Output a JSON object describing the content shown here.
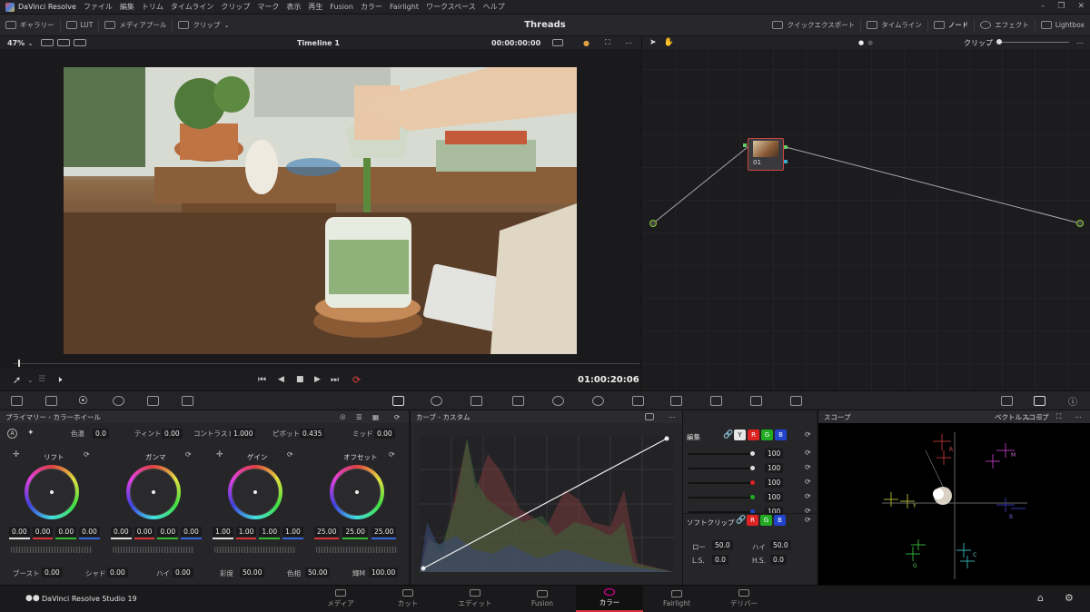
{
  "app": {
    "name": "DaVinci Resolve",
    "footer_name": "DaVinci Resolve Studio 19",
    "page_title": "Threads"
  },
  "menu": [
    "ファイル",
    "編集",
    "トリム",
    "タイムライン",
    "クリップ",
    "マーク",
    "表示",
    "再生",
    "Fusion",
    "カラー",
    "Fairlight",
    "ワークスペース",
    "ヘルプ"
  ],
  "toolbar": {
    "left": [
      "ギャラリー",
      "LUT",
      "メディアプール",
      "クリップ"
    ],
    "right": [
      "クイックエクスポート",
      "タイムライン",
      "ノード",
      "エフェクト",
      "Lightbox"
    ]
  },
  "viewer": {
    "zoom": "47%",
    "timeline_name": "Timeline 1",
    "timecode_top": "00:00:00:00",
    "timecode": "01:00:20:06",
    "progress": 0.01
  },
  "nodes": {
    "dropdown": "クリップ",
    "node_label": "01"
  },
  "primaries": {
    "title": "プライマリー - カラーホイール",
    "top_params": [
      {
        "label": "色温",
        "value": "0.0"
      },
      {
        "label": "ティント",
        "value": "0.00"
      },
      {
        "label": "コントラスト",
        "value": "1.000"
      },
      {
        "label": "ピボット",
        "value": "0.435"
      },
      {
        "label": "ミッド",
        "value": "0.00"
      }
    ],
    "wheels": [
      {
        "name": "リフト",
        "values": [
          "0.00",
          "0.00",
          "0.00",
          "0.00"
        ]
      },
      {
        "name": "ガンマ",
        "values": [
          "0.00",
          "0.00",
          "0.00",
          "0.00"
        ]
      },
      {
        "name": "ゲイン",
        "values": [
          "1.00",
          "1.00",
          "1.00",
          "1.00"
        ]
      },
      {
        "name": "オフセット",
        "values": [
          "25.00",
          "25.00",
          "25.00"
        ]
      }
    ],
    "bottom_params": [
      {
        "label": "ブースト",
        "value": "0.00"
      },
      {
        "label": "シャド",
        "value": "0.00"
      },
      {
        "label": "ハイ",
        "value": "0.00"
      },
      {
        "label": "彩度",
        "value": "50.00"
      },
      {
        "label": "色相",
        "value": "50.00"
      },
      {
        "label": "輝M",
        "value": "100.00"
      }
    ]
  },
  "curves": {
    "title": "カーブ - カスタム"
  },
  "edit": {
    "title": "編集",
    "channels": [
      "Y",
      "R",
      "G",
      "B"
    ],
    "values": [
      "100",
      "100",
      "100",
      "100",
      "100"
    ],
    "soft_clip": {
      "title": "ソフトクリップ",
      "channels": [
        "R",
        "G",
        "B"
      ],
      "low_label": "ロー",
      "low": "50.0",
      "high_label": "ハイ",
      "high": "50.0",
      "ls_label": "L.S.",
      "ls": "0.0",
      "hs_label": "H.S.",
      "hs": "0.0"
    }
  },
  "scope": {
    "title": "スコープ",
    "mode": "ベクトルスコープ",
    "markers": [
      "R",
      "M",
      "Y",
      "B",
      "G",
      "C"
    ]
  },
  "pages": [
    "メディア",
    "カット",
    "エディット",
    "Fusion",
    "カラー",
    "Fairlight",
    "デリバー"
  ],
  "active_page": "カラー",
  "colors": {
    "accent": "#d6353c",
    "red": "#d33",
    "green": "#3b3",
    "blue": "#36d"
  }
}
